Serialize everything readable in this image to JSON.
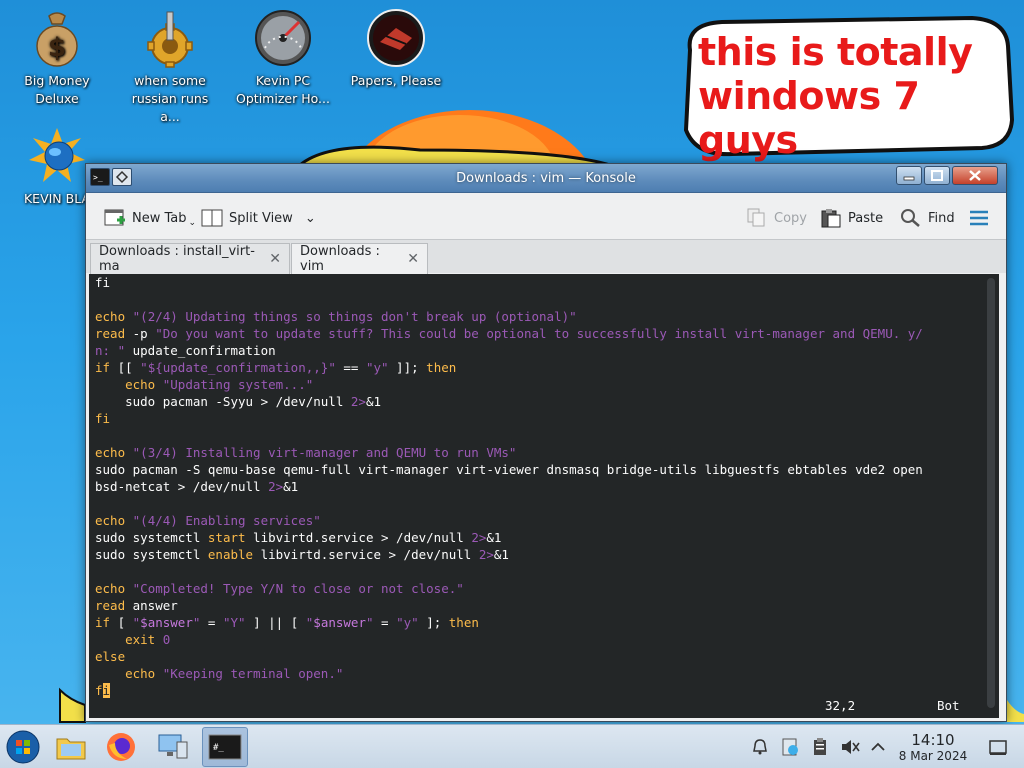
{
  "desktop": {
    "icons": [
      {
        "label": "Big Money\nDeluxe",
        "icon": "money-bag-icon"
      },
      {
        "label": "when some\nrussian runs a...",
        "icon": "gear-icon"
      },
      {
        "label": "Kevin PC\nOptimizer Ho...",
        "icon": "speedometer-icon"
      },
      {
        "label": "Papers, Please",
        "icon": "papers-please-icon"
      },
      {
        "label": "KEVIN BLA",
        "icon": "globe-burst-icon"
      }
    ],
    "bubble_text_1": "this is totally",
    "bubble_text_2": "windows 7 guys"
  },
  "window": {
    "title": "Downloads : vim — Konsole",
    "toolbar": {
      "new_tab": "New Tab",
      "split_view": "Split View",
      "copy": "Copy",
      "paste": "Paste",
      "find": "Find"
    },
    "tabs": [
      {
        "label": "Downloads : install_virt-ma"
      },
      {
        "label": "Downloads : vim"
      }
    ],
    "terminal": {
      "status_position": "32,2",
      "status_scroll": "Bot"
    }
  },
  "taskbar": {
    "time": "14:10",
    "date": "8 Mar 2024"
  },
  "colors": {
    "keyword": "#fdbc4b",
    "string": "#9b59b6",
    "terminal_bg": "#232627",
    "bubble_text": "#e81a1a"
  }
}
